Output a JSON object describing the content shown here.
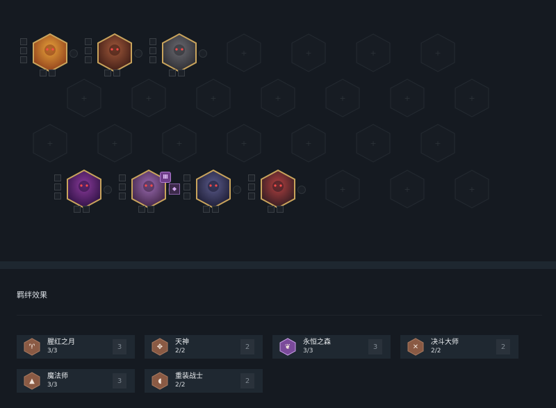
{
  "traits_heading": "羁绊效果",
  "traits": [
    {
      "name": "腥红之月",
      "count": "3/3",
      "level": "3",
      "icon": "horned-mask-icon",
      "color": "#8a5a44"
    },
    {
      "name": "天神",
      "count": "2/2",
      "level": "2",
      "icon": "trinity-knot-icon",
      "color": "#8a5a44"
    },
    {
      "name": "永恒之森",
      "count": "3/3",
      "level": "3",
      "icon": "leaf-icon",
      "color": "#7a4a9a"
    },
    {
      "name": "决斗大师",
      "count": "2/2",
      "level": "2",
      "icon": "crossed-swords-icon",
      "color": "#8a5a44"
    },
    {
      "name": "魔法师",
      "count": "3/3",
      "level": "3",
      "icon": "wizard-hat-icon",
      "color": "#8a5a44"
    },
    {
      "name": "重装战士",
      "count": "2/2",
      "level": "2",
      "icon": "helmet-icon",
      "color": "#8a5a44"
    }
  ],
  "champions": [
    {
      "name": "champion-fire-warrior",
      "colors": [
        "#e8a33a",
        "#8a3a1a"
      ]
    },
    {
      "name": "champion-dark-armored",
      "colors": [
        "#a0583a",
        "#3a1a14"
      ]
    },
    {
      "name": "champion-gray-beast",
      "colors": [
        "#6a6a70",
        "#2a2a30"
      ]
    },
    {
      "name": "champion-purple-mage",
      "colors": [
        "#8a3a9a",
        "#2a1040"
      ]
    },
    {
      "name": "champion-witch-girl",
      "colors": [
        "#9a6ab0",
        "#3a2040"
      ]
    },
    {
      "name": "champion-night-hunter",
      "colors": [
        "#5a5a8a",
        "#1a1a30"
      ]
    },
    {
      "name": "champion-red-eyed-knight",
      "colors": [
        "#b04040",
        "#2a1a20"
      ]
    }
  ],
  "star_badge": "Ⅲ"
}
